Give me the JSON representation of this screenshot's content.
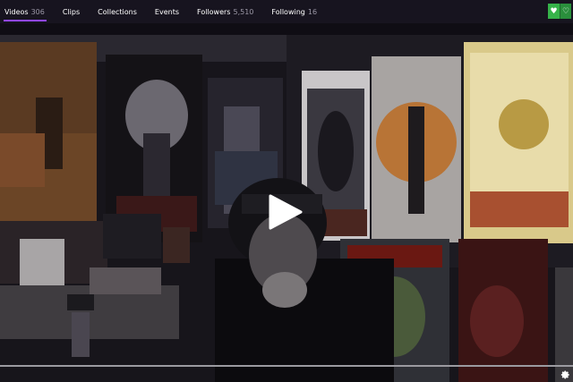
{
  "nav": {
    "tabs": [
      {
        "label": "Videos",
        "count": "306",
        "active": true
      },
      {
        "label": "Clips",
        "count": ""
      },
      {
        "label": "Collections",
        "count": ""
      },
      {
        "label": "Events",
        "count": ""
      },
      {
        "label": "Followers",
        "count": "5,510"
      },
      {
        "label": "Following",
        "count": "16"
      }
    ],
    "follow_icon": "heart-icon",
    "notify_icon": "heart-outline-icon"
  },
  "player": {
    "play_icon": "play-icon",
    "settings_icon": "gear-icon",
    "progress": 0,
    "accent": "#9147ff",
    "follow_color": "#36b34a"
  }
}
